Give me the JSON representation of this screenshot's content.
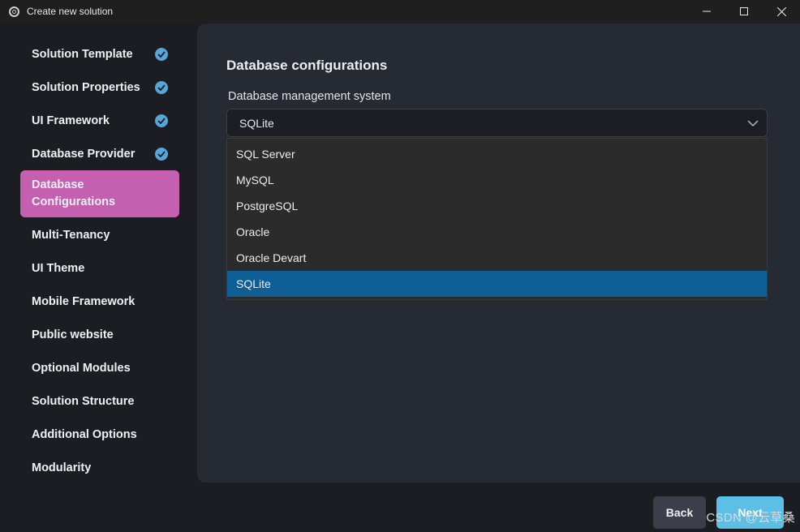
{
  "window": {
    "title": "Create new solution",
    "icon": "app-logo-icon",
    "controls": [
      "minimize-icon",
      "maximize-icon",
      "close-icon"
    ]
  },
  "sidebar": {
    "items": [
      {
        "label": "Solution Template",
        "completed": true
      },
      {
        "label": "Solution Properties",
        "completed": true
      },
      {
        "label": "UI Framework",
        "completed": true
      },
      {
        "label": "Database Provider",
        "completed": true
      },
      {
        "label": "Database\nConfigurations",
        "completed": false,
        "active": true
      },
      {
        "label": "Multi-Tenancy",
        "completed": false
      },
      {
        "label": "UI Theme",
        "completed": false
      },
      {
        "label": "Mobile Framework",
        "completed": false
      },
      {
        "label": "Public website",
        "completed": false
      },
      {
        "label": "Optional Modules",
        "completed": false
      },
      {
        "label": "Solution Structure",
        "completed": false
      },
      {
        "label": "Additional Options",
        "completed": false
      },
      {
        "label": "Modularity",
        "completed": false
      }
    ]
  },
  "main": {
    "section_title": "Database configurations",
    "dbms": {
      "label": "Database management system",
      "selected": "SQLite",
      "options": [
        "SQL Server",
        "MySQL",
        "PostgreSQL",
        "Oracle",
        "Oracle Devart",
        "SQLite"
      ]
    }
  },
  "footer": {
    "back_label": "Back",
    "next_label": "Next"
  },
  "watermark": "CSDN @云草桑",
  "colors": {
    "active_nav": "#c460af",
    "check": "#56a6d8",
    "selected_option": "#0f5f97",
    "next_button": "#5bbfe6"
  }
}
